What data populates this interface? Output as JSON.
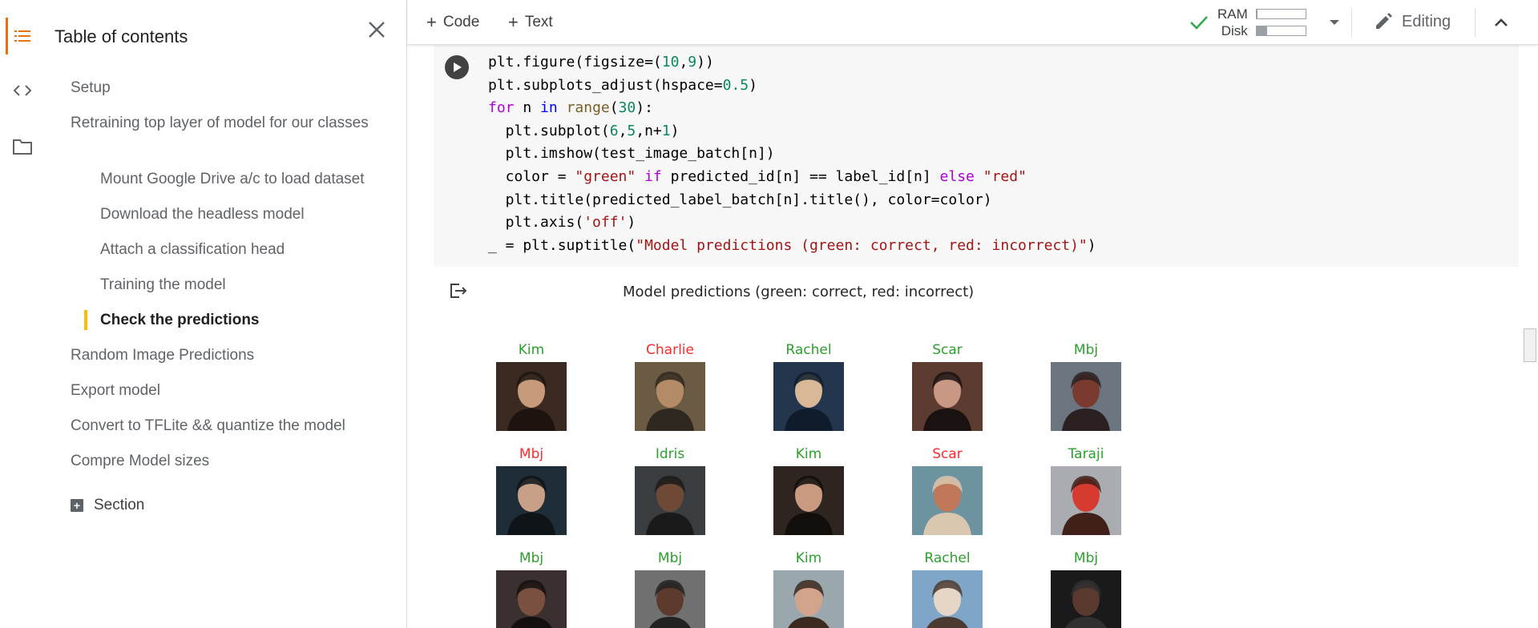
{
  "toc": {
    "title": "Table of contents",
    "items": [
      {
        "label": "Setup",
        "level": 1
      },
      {
        "label": "Retraining top layer of model for our classes",
        "level": 1
      },
      {
        "label": "Mount Google Drive a/c to load dataset",
        "level": 2
      },
      {
        "label": "Download the headless model",
        "level": 2
      },
      {
        "label": "Attach a classification head",
        "level": 2
      },
      {
        "label": "Training the model",
        "level": 2
      },
      {
        "label": "Check the predictions",
        "level": 2,
        "current": true
      },
      {
        "label": "Random Image Predictions",
        "level": 1
      },
      {
        "label": "Export model",
        "level": 1
      },
      {
        "label": "Convert to TFLite && quantize the model",
        "level": 1
      },
      {
        "label": "Compre Model sizes",
        "level": 1
      }
    ],
    "section_label": "Section"
  },
  "rail": {
    "icons": [
      "table-of-contents-icon",
      "code-snippets-icon",
      "files-folder-icon"
    ]
  },
  "toolbar": {
    "add_code": "Code",
    "add_text": "Text",
    "ram_label": "RAM",
    "disk_label": "Disk",
    "ram_usage": 0.02,
    "disk_usage": 0.22,
    "editing_label": "Editing"
  },
  "cell": {
    "code_lines": [
      "plt.figure(figsize=(10,9))",
      "plt.subplots_adjust(hspace=0.5)",
      "for n in range(30):",
      "  plt.subplot(6,5,n+1)",
      "  plt.imshow(test_image_batch[n])",
      "  color = \"green\" if predicted_id[n] == label_id[n] else \"red\"",
      "  plt.title(predicted_label_batch[n].title(), color=color)",
      "  plt.axis('off')",
      "_ = plt.suptitle(\"Model predictions (green: correct, red: incorrect)\")"
    ]
  },
  "output": {
    "suptitle": "Model predictions (green: correct, red: incorrect)",
    "colors": {
      "correct": "#2ca02c",
      "incorrect": "#ff2a2a"
    },
    "predictions": [
      {
        "label": "Kim",
        "correct": true
      },
      {
        "label": "Charlie",
        "correct": false
      },
      {
        "label": "Rachel",
        "correct": true
      },
      {
        "label": "Scar",
        "correct": true
      },
      {
        "label": "Mbj",
        "correct": true
      },
      {
        "label": "Mbj",
        "correct": false
      },
      {
        "label": "Idris",
        "correct": true
      },
      {
        "label": "Kim",
        "correct": true
      },
      {
        "label": "Scar",
        "correct": false
      },
      {
        "label": "Taraji",
        "correct": true
      },
      {
        "label": "Mbj",
        "correct": true
      },
      {
        "label": "Mbj",
        "correct": true
      },
      {
        "label": "Kim",
        "correct": true
      },
      {
        "label": "Rachel",
        "correct": true
      },
      {
        "label": "Mbj",
        "correct": true
      }
    ]
  },
  "theme": {
    "accent": "#e8710a",
    "toc_marker": "#fbbc04",
    "run_check": "#34a853"
  }
}
